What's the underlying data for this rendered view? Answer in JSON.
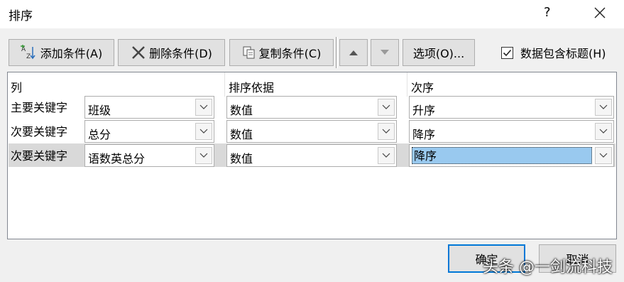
{
  "window": {
    "title": "排序",
    "help": "?"
  },
  "toolbar": {
    "add": "添加条件(A)",
    "delete": "删除条件(D)",
    "copy": "复制条件(C)",
    "options": "选项(O)...",
    "header_checkbox": {
      "label": "数据包含标题(H)",
      "checked": true
    }
  },
  "grid": {
    "headers": {
      "column": "列",
      "sort_on": "排序依据",
      "order": "次序"
    },
    "rows": [
      {
        "label": "主要关键字",
        "column": "班级",
        "sort_on": "数值",
        "order": "升序"
      },
      {
        "label": "次要关键字",
        "column": "总分",
        "sort_on": "数值",
        "order": "降序"
      },
      {
        "label": "次要关键字",
        "column": "语数英总分",
        "sort_on": "数值",
        "order": "降序"
      }
    ]
  },
  "footer": {
    "ok": "确定",
    "cancel": "取消"
  },
  "watermark": "头条 @一剑流科技"
}
